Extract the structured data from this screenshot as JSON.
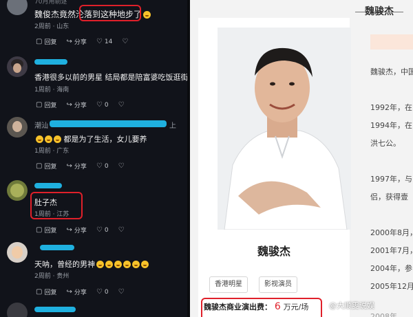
{
  "left_panel": {
    "comments": [
      {
        "header_partial": "70月用剔逐",
        "text_before": "魏俊杰竟然",
        "text_highlight": "沦落到这种地步了",
        "meta": "2周前 · 山东",
        "reply_label": "回复",
        "share_label": "分享",
        "like_count": "14"
      },
      {
        "text": "香港很多以前的男星 结局都是陪富婆吃饭逛街",
        "meta": "1周前 · 海南",
        "reply_label": "回复",
        "share_label": "分享",
        "like_count": "0"
      },
      {
        "name_partial": "潮汕",
        "name_tail": "上",
        "text": "都是为了生活，女儿要养",
        "meta": "1周前 · 广东",
        "reply_label": "回复",
        "share_label": "分享",
        "like_count": "0"
      },
      {
        "text": "肚子杰",
        "meta": "1周前 · 江苏",
        "reply_label": "回复",
        "share_label": "分享",
        "like_count": "0"
      },
      {
        "text": "天呐，曾经的男神",
        "meta": "2周前 · 贵州",
        "reply_label": "回复",
        "share_label": "分享",
        "like_count": "0"
      }
    ]
  },
  "right_panel": {
    "title": "魏骏杰",
    "card": {
      "name": "魏骏杰",
      "tags": [
        "香港明星",
        "影视演员"
      ],
      "fee_label": "魏骏杰商业演出费：",
      "fee_amount": "6",
      "fee_unit": "万元/场"
    },
    "timeline": [
      "魏骏杰，中国",
      "1992年，在",
      "1994年，在",
      "洪七公。",
      "1997年，与",
      "侣，获得壹",
      "2000年8月，",
      "2001年7月，",
      "2004年，参",
      "2005年12月",
      "2008年"
    ],
    "watermark": "@大顺雯说娱"
  },
  "colors": {
    "accent_red": "#e0202a",
    "scribble_blue": "#1fb0df",
    "dark_bg": "#11131a"
  }
}
